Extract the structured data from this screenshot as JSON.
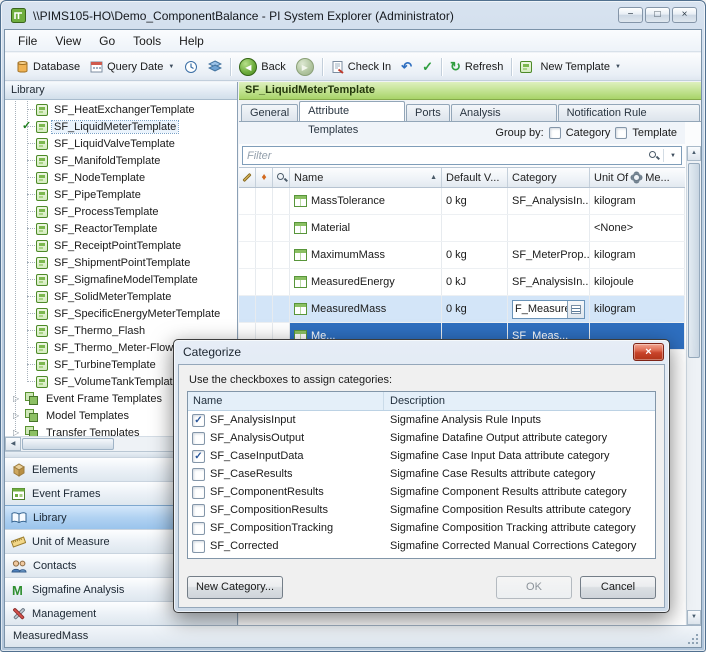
{
  "window": {
    "title": "\\\\PIMS105-HO\\Demo_ComponentBalance - PI System Explorer (Administrator)"
  },
  "icons": {
    "minimize": "−",
    "maximize": "□",
    "close": "×",
    "caret_down": "▼",
    "sort_asc": "▲",
    "diamond": "♦",
    "back_arrow": "◀",
    "forward_arrow": "▶",
    "undo": "↶",
    "check": "✓",
    "refresh": "↻",
    "expander": "▷",
    "scroll_left": "◀",
    "scroll_right": "▶",
    "scroll_up": "▲",
    "scroll_down": "▼"
  },
  "menu": {
    "items": [
      "File",
      "View",
      "Go",
      "Tools",
      "Help"
    ]
  },
  "toolbar": {
    "database": "Database",
    "query_date": "Query Date",
    "back": "Back",
    "check_in": "Check In",
    "refresh": "Refresh",
    "new_template": "New Template"
  },
  "library": {
    "header": "Library",
    "items": [
      "SF_HeatExchangerTemplate",
      "SF_LiquidMeterTemplate",
      "SF_LiquidValveTemplate",
      "SF_ManifoldTemplate",
      "SF_NodeTemplate",
      "SF_PipeTemplate",
      "SF_ProcessTemplate",
      "SF_ReactorTemplate",
      "SF_ReceiptPointTemplate",
      "SF_ShipmentPointTemplate",
      "SF_SigmafineModelTemplate",
      "SF_SolidMeterTemplate",
      "SF_SpecificEnergyMeterTemplate",
      "SF_Thermo_Flash",
      "SF_Thermo_Meter-Flow",
      "SF_TurbineTemplate",
      "SF_VolumeTankTemplate"
    ],
    "groups": [
      "Event Frame Templates",
      "Model Templates",
      "Transfer Templates"
    ],
    "nav": [
      "Elements",
      "Event Frames",
      "Library",
      "Unit of Measure",
      "Contacts",
      "Sigmafine Analysis",
      "Management"
    ]
  },
  "main": {
    "header": "SF_LiquidMeterTemplate",
    "tabs": [
      "General",
      "Attribute Templates",
      "Ports",
      "Analysis Templates",
      "Notification Rule Templates"
    ],
    "group_by": {
      "label": "Group by:",
      "category": "Category",
      "template": "Template"
    },
    "filter_placeholder": "Filter",
    "columns": {
      "name": "Name",
      "default": "Default V...",
      "category": "Category",
      "unit_prefix": "Unit Of",
      "unit_suffix": "Me..."
    },
    "rows": [
      {
        "name": "MassTolerance",
        "default": "0 kg",
        "category": "SF_AnalysisIn...",
        "unit": "kilogram"
      },
      {
        "name": "Material",
        "default": "",
        "category": "",
        "unit": "<None>"
      },
      {
        "name": "MaximumMass",
        "default": "0 kg",
        "category": "SF_MeterProp...",
        "unit": "kilogram"
      },
      {
        "name": "MeasuredEnergy",
        "default": "0 kJ",
        "category": "SF_AnalysisIn...",
        "unit": "kilojoule"
      },
      {
        "name": "MeasuredMass",
        "default": "0 kg",
        "category_edit": "F_Measured",
        "unit": "kilogram"
      },
      {
        "name": "Me...",
        "default": "",
        "category": "SF_Meas...",
        "unit": ""
      }
    ]
  },
  "dialog": {
    "title": "Categorize",
    "instruction": "Use the checkboxes to assign categories:",
    "columns": {
      "name": "Name",
      "description": "Description"
    },
    "rows": [
      {
        "check": "✓",
        "name": "SF_AnalysisInput",
        "description": "Sigmafine Analysis Rule Inputs"
      },
      {
        "check": "",
        "name": "SF_AnalysisOutput",
        "description": "Sigmafine Datafine Output attribute category"
      },
      {
        "check": "✓",
        "name": "SF_CaseInputData",
        "description": "Sigmafine Case Input Data attribute category"
      },
      {
        "check": "",
        "name": "SF_CaseResults",
        "description": "Sigmafine Case Results attribute category"
      },
      {
        "check": "",
        "name": "SF_ComponentResults",
        "description": "Sigmafine Component Results attribute category"
      },
      {
        "check": "",
        "name": "SF_CompositionResults",
        "description": "Sigmafine Composition Results attribute category"
      },
      {
        "check": "",
        "name": "SF_CompositionTracking",
        "description": "Sigmafine Composition Tracking attribute category"
      },
      {
        "check": "",
        "name": "SF_Corrected",
        "description": "Sigmafine Corrected Manual Corrections Category"
      }
    ],
    "buttons": {
      "new_category": "New Category...",
      "ok": "OK",
      "cancel": "Cancel"
    }
  },
  "status": {
    "text": "MeasuredMass"
  }
}
